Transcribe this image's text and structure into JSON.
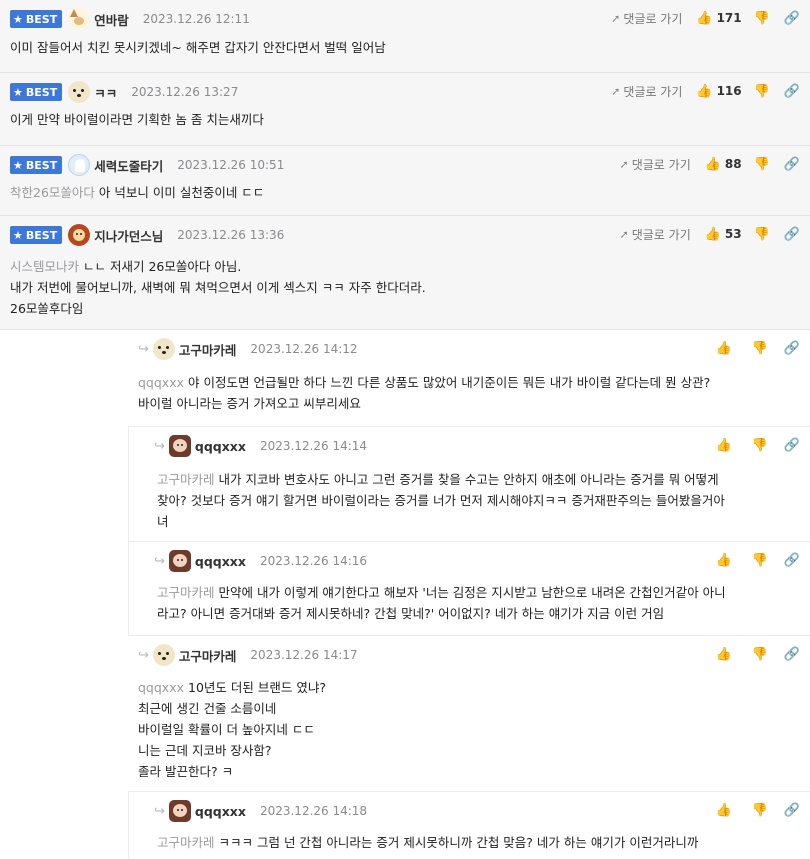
{
  "labels": {
    "best": "BEST",
    "goto_reply": "댓글로 가기"
  },
  "icons": {
    "star": "★",
    "goto": "➚",
    "like": "👍",
    "dislike": "👎",
    "share": "🔗",
    "reply_arrow": "↪"
  },
  "best_comments": [
    {
      "nick": "연바람",
      "date": "2023.12.26 12:11",
      "likes": "171",
      "avatar": "fox-avatar",
      "lines": [
        "이미 잠들어서 치킨 못시키겠네~ 해주면 갑자기 안잔다면서 벌떡 일어남"
      ],
      "mention": ""
    },
    {
      "nick": "ㅋㅋ",
      "date": "2023.12.26 13:27",
      "likes": "116",
      "avatar": "dog-avatar",
      "lines": [
        "이게 만약 바이럴이라면 기획한 놈 좀 치는새끼다"
      ],
      "mention": ""
    },
    {
      "nick": "세력도줄타기",
      "date": "2023.12.26 10:51",
      "likes": "88",
      "avatar": "ghost-avatar",
      "mention": "착한26모쏠아다",
      "lines": [
        "아 넉보니 이미 실천중이네 ㄷㄷ"
      ]
    },
    {
      "nick": "지나가던스님",
      "date": "2023.12.26 13:36",
      "likes": "53",
      "avatar": "lion-avatar",
      "mention": "시스템모나카",
      "lines": [
        "ㄴㄴ 저새기 26모쏠아다 아님.",
        "내가 저번에 물어보니까, 새벽에 뭐 쳐먹으면서 이게 섹스지 ㅋㅋ 자주 한다더라.",
        "26모쏠후다임"
      ]
    }
  ],
  "replies": [
    {
      "nick": "고구마카레",
      "date": "2023.12.26 14:12",
      "mention": "qqqxxx",
      "lines": [
        "야 이정도면 언급될만 하다 느낀 다른 상품도 많았어 내기준이든 뭐든 내가 바이럴 같다는데 뭔 상관?",
        "바이럴 아니라는 증거 가져오고 씨부리세요"
      ]
    },
    {
      "nick": "qqqxxx",
      "date": "2023.12.26 14:14",
      "mention": "고구마카레",
      "lines": [
        "내가 지코바 변호사도 아니고 그런 증거를 찾을 수고는 안하지 애초에 아니라는 증거를 뭐 어떻게",
        "찾아? 것보다 증거 얘기 할거면 바이럴이라는 증거를 너가 먼저 제시해야지ㅋㅋ 증거재판주의는 들어봤을거아",
        "녀"
      ]
    },
    {
      "nick": "qqqxxx",
      "date": "2023.12.26 14:16",
      "mention": "고구마카레",
      "lines": [
        "만약에 내가 이렇게 얘기한다고 해보자 '너는 김정은 지시받고 남한으로 내려온 간첩인거같아 아니",
        "라고? 아니면 증거대봐 증거 제시못하네? 간첩 맞네?' 어이없지? 네가 하는 얘기가 지금 이런 거임"
      ]
    },
    {
      "nick": "고구마카레",
      "date": "2023.12.26 14:17",
      "mention": "qqqxxx",
      "lines": [
        "10년도 더된 브랜드 였냐?",
        "최근에 생긴 건줄 소름이네",
        "바이럴일 확률이 더 높아지네 ㄷㄷ",
        "니는 근데 지코바 장사함?",
        "졸라 발끈한다? ㅋ"
      ]
    },
    {
      "nick": "qqqxxx",
      "date": "2023.12.26 14:18",
      "mention": "고구마카레",
      "lines": [
        "ㅋㅋㅋ 그럼 넌 간첩 아니라는 증거 제시못하니까 간첩 맞음? 네가 하는 얘기가 이런거라니까"
      ]
    }
  ]
}
